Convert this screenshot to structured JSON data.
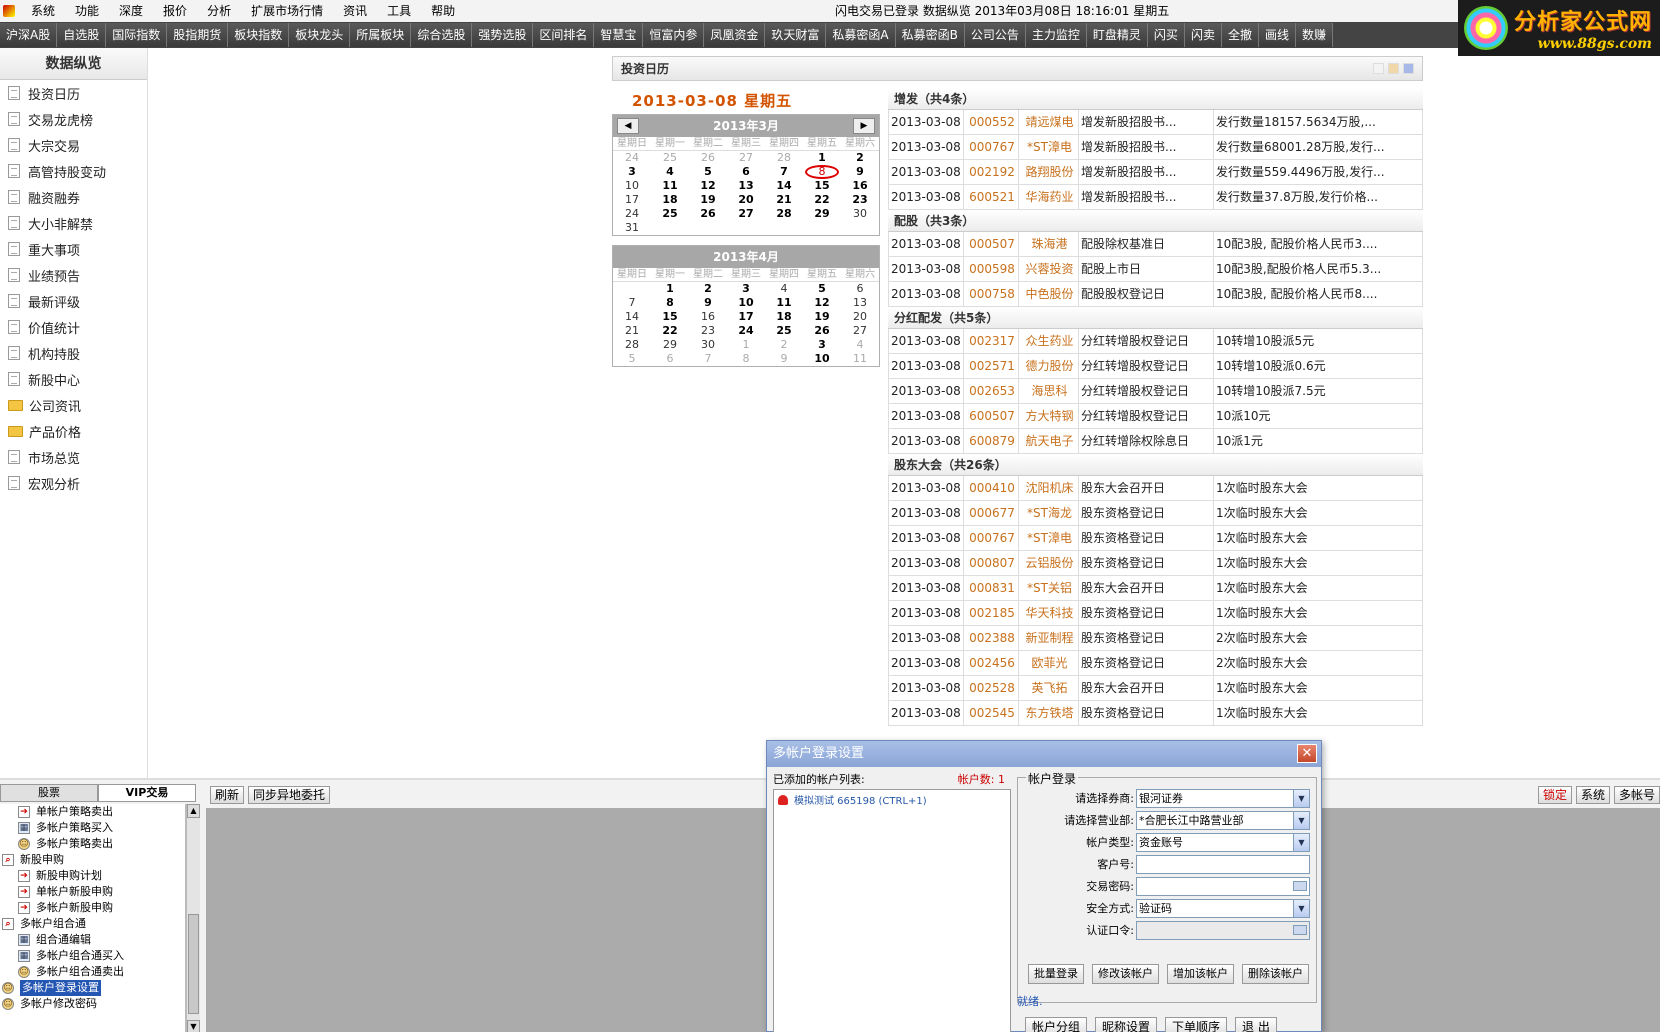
{
  "menu": {
    "items": [
      "系统",
      "功能",
      "深度",
      "报价",
      "分析",
      "扩展市场行情",
      "资讯",
      "工具",
      "帮助"
    ],
    "status": "闪电交易已登录    数据纵览  2013年03月08日  18:16:01  星期五"
  },
  "logo": {
    "brand": "分析家公式网",
    "url": "www.88gs.com"
  },
  "toolbar": [
    "沪深A股",
    "自选股",
    "国际指数",
    "股指期货",
    "板块指数",
    "板块龙头",
    "所属板块",
    "综合选股",
    "强势选股",
    "区间排名",
    "智慧宝",
    "恒富内参",
    "凤凰资金",
    "玖天财富",
    "私募密函A",
    "私募密函B",
    "公司公告",
    "主力监控",
    "盯盘精灵",
    "闪买",
    "闪卖",
    "全撤",
    "画线",
    "数赚"
  ],
  "sidebar": {
    "title": "数据纵览",
    "items": [
      {
        "label": "投资日历",
        "icon": "document-icon"
      },
      {
        "label": "交易龙虎榜",
        "icon": "document-icon"
      },
      {
        "label": "大宗交易",
        "icon": "document-icon"
      },
      {
        "label": "高管持股变动",
        "icon": "document-icon"
      },
      {
        "label": "融资融券",
        "icon": "document-icon"
      },
      {
        "label": "大小非解禁",
        "icon": "document-icon"
      },
      {
        "label": "重大事项",
        "icon": "document-icon"
      },
      {
        "label": "业绩预告",
        "icon": "document-icon"
      },
      {
        "label": "最新评级",
        "icon": "document-icon"
      },
      {
        "label": "价值统计",
        "icon": "document-icon"
      },
      {
        "label": "机构持股",
        "icon": "document-icon"
      },
      {
        "label": "新股中心",
        "icon": "document-icon"
      },
      {
        "label": "公司资讯",
        "icon": "folder-icon"
      },
      {
        "label": "产品价格",
        "icon": "folder-icon"
      },
      {
        "label": "市场总览",
        "icon": "document-icon"
      },
      {
        "label": "宏观分析",
        "icon": "document-icon"
      }
    ]
  },
  "calendar": {
    "panel_title": "投资日历",
    "selected_date": "2013-03-08  星期五",
    "swatch_colors": [
      "#f3f3f3",
      "#f0d8a8",
      "#a8b8e8"
    ],
    "weekdays": [
      "星期日",
      "星期一",
      "星期二",
      "星期三",
      "星期四",
      "星期五",
      "星期六"
    ],
    "months": [
      {
        "title": "2013年3月",
        "weeks": [
          [
            [
              "24",
              "dim"
            ],
            [
              "25",
              "dim"
            ],
            [
              "26",
              "dim"
            ],
            [
              "27",
              "dim"
            ],
            [
              "28",
              "dim"
            ],
            [
              "1",
              "bold"
            ],
            [
              "2",
              "bold"
            ]
          ],
          [
            [
              "3",
              "bold"
            ],
            [
              "4",
              "bold"
            ],
            [
              "5",
              "bold"
            ],
            [
              "6",
              "bold"
            ],
            [
              "7",
              "bold"
            ],
            [
              "8",
              "today"
            ],
            [
              "9",
              "bold"
            ]
          ],
          [
            [
              "10",
              "reg"
            ],
            [
              "11",
              "bold"
            ],
            [
              "12",
              "bold"
            ],
            [
              "13",
              "bold"
            ],
            [
              "14",
              "bold"
            ],
            [
              "15",
              "bold"
            ],
            [
              "16",
              "bold"
            ]
          ],
          [
            [
              "17",
              "reg"
            ],
            [
              "18",
              "bold"
            ],
            [
              "19",
              "bold"
            ],
            [
              "20",
              "bold"
            ],
            [
              "21",
              "bold"
            ],
            [
              "22",
              "bold"
            ],
            [
              "23",
              "bold"
            ]
          ],
          [
            [
              "24",
              "reg"
            ],
            [
              "25",
              "bold"
            ],
            [
              "26",
              "bold"
            ],
            [
              "27",
              "bold"
            ],
            [
              "28",
              "bold"
            ],
            [
              "29",
              "bold"
            ],
            [
              "30",
              "reg"
            ]
          ],
          [
            [
              "31",
              "reg"
            ]
          ]
        ]
      },
      {
        "title": "2013年4月",
        "weeks": [
          [
            [
              "",
              "reg"
            ],
            [
              "1",
              "bold"
            ],
            [
              "2",
              "bold"
            ],
            [
              "3",
              "bold"
            ],
            [
              "4",
              "reg"
            ],
            [
              "5",
              "bold"
            ],
            [
              "6",
              "reg"
            ]
          ],
          [
            [
              "7",
              "reg"
            ],
            [
              "8",
              "bold"
            ],
            [
              "9",
              "bold"
            ],
            [
              "10",
              "bold"
            ],
            [
              "11",
              "bold"
            ],
            [
              "12",
              "bold"
            ],
            [
              "13",
              "reg"
            ]
          ],
          [
            [
              "14",
              "reg"
            ],
            [
              "15",
              "bold"
            ],
            [
              "16",
              "reg"
            ],
            [
              "17",
              "bold"
            ],
            [
              "18",
              "bold"
            ],
            [
              "19",
              "bold"
            ],
            [
              "20",
              "reg"
            ]
          ],
          [
            [
              "21",
              "reg"
            ],
            [
              "22",
              "bold"
            ],
            [
              "23",
              "reg"
            ],
            [
              "24",
              "bold"
            ],
            [
              "25",
              "bold"
            ],
            [
              "26",
              "bold"
            ],
            [
              "27",
              "reg"
            ]
          ],
          [
            [
              "28",
              "reg"
            ],
            [
              "29",
              "reg"
            ],
            [
              "30",
              "reg"
            ],
            [
              "1",
              "dim"
            ],
            [
              "2",
              "dim"
            ],
            [
              "3",
              "bold"
            ],
            [
              "4",
              "dim"
            ]
          ],
          [
            [
              "5",
              "dim"
            ],
            [
              "6",
              "dim"
            ],
            [
              "7",
              "dim"
            ],
            [
              "8",
              "dim"
            ],
            [
              "9",
              "dim"
            ],
            [
              "10",
              "bold"
            ],
            [
              "11",
              "dim"
            ]
          ]
        ]
      }
    ]
  },
  "events": [
    {
      "title": "增发（共4条）",
      "rows": [
        [
          "2013-03-08",
          "000552",
          "靖远煤电",
          "增发新股招股书...",
          "发行数量18157.5634万股,..."
        ],
        [
          "2013-03-08",
          "000767",
          "*ST漳电",
          "增发新股招股书...",
          "发行数量68001.28万股,发行..."
        ],
        [
          "2013-03-08",
          "002192",
          "路翔股份",
          "增发新股招股书...",
          "发行数量559.4496万股,发行..."
        ],
        [
          "2013-03-08",
          "600521",
          "华海药业",
          "增发新股招股书...",
          "发行数量37.8万股,发行价格..."
        ]
      ]
    },
    {
      "title": "配股（共3条）",
      "rows": [
        [
          "2013-03-08",
          "000507",
          "珠海港",
          "配股除权基准日",
          "10配3股, 配股价格人民币3...."
        ],
        [
          "2013-03-08",
          "000598",
          "兴蓉投资",
          "配股上市日",
          "10配3股,配股价格人民币5.3..."
        ],
        [
          "2013-03-08",
          "000758",
          "中色股份",
          "配股股权登记日",
          "10配3股, 配股价格人民币8...."
        ]
      ]
    },
    {
      "title": "分红配发（共5条）",
      "rows": [
        [
          "2013-03-08",
          "002317",
          "众生药业",
          "分红转增股权登记日",
          "10转增10股派5元"
        ],
        [
          "2013-03-08",
          "002571",
          "德力股份",
          "分红转增股权登记日",
          "10转增10股派0.6元"
        ],
        [
          "2013-03-08",
          "002653",
          "海思科",
          "分红转增股权登记日",
          "10转增10股派7.5元"
        ],
        [
          "2013-03-08",
          "600507",
          "方大特钢",
          "分红转增股权登记日",
          "10派10元"
        ],
        [
          "2013-03-08",
          "600879",
          "航天电子",
          "分红转增除权除息日",
          "10派1元"
        ]
      ]
    },
    {
      "title": "股东大会（共26条）",
      "rows": [
        [
          "2013-03-08",
          "000410",
          "沈阳机床",
          "股东大会召开日",
          "1次临时股东大会"
        ],
        [
          "2013-03-08",
          "000677",
          "*ST海龙",
          "股东资格登记日",
          "1次临时股东大会"
        ],
        [
          "2013-03-08",
          "000767",
          "*ST漳电",
          "股东资格登记日",
          "1次临时股东大会"
        ],
        [
          "2013-03-08",
          "000807",
          "云铝股份",
          "股东资格登记日",
          "1次临时股东大会"
        ],
        [
          "2013-03-08",
          "000831",
          "*ST关铝",
          "股东大会召开日",
          "1次临时股东大会"
        ],
        [
          "2013-03-08",
          "002185",
          "华天科技",
          "股东资格登记日",
          "1次临时股东大会"
        ],
        [
          "2013-03-08",
          "002388",
          "新亚制程",
          "股东资格登记日",
          "2次临时股东大会"
        ],
        [
          "2013-03-08",
          "002456",
          "欧菲光",
          "股东资格登记日",
          "2次临时股东大会"
        ],
        [
          "2013-03-08",
          "002528",
          "英飞拓",
          "股东大会召开日",
          "1次临时股东大会"
        ],
        [
          "2013-03-08",
          "002545",
          "东方铁塔",
          "股东资格登记日",
          "1次临时股东大会"
        ]
      ]
    }
  ],
  "bottom": {
    "tabs": [
      "股票",
      "VIP交易"
    ],
    "toolbar": [
      "刷新",
      "同步异地委托"
    ],
    "right_buttons": [
      "锁定",
      "系统",
      "多帐号"
    ],
    "tree": [
      {
        "label": "单帐户策略卖出",
        "level": 1,
        "icon": "arrow-icon"
      },
      {
        "label": "多帐户策略买入",
        "level": 1,
        "icon": "grid-icon"
      },
      {
        "label": "多帐户策略卖出",
        "level": 1,
        "icon": "user-icon"
      },
      {
        "label": "新股申购",
        "level": 0,
        "icon": "search-icon"
      },
      {
        "label": "新股申购计划",
        "level": 1,
        "icon": "arrow-icon"
      },
      {
        "label": "单帐户新股申购",
        "level": 1,
        "icon": "arrow-icon"
      },
      {
        "label": "多帐户新股申购",
        "level": 1,
        "icon": "arrow-icon"
      },
      {
        "label": "多帐户组合通",
        "level": 0,
        "icon": "search-icon"
      },
      {
        "label": "组合通编辑",
        "level": 1,
        "icon": "grid-icon"
      },
      {
        "label": "多帐户组合通买入",
        "level": 1,
        "icon": "grid-icon"
      },
      {
        "label": "多帐户组合通卖出",
        "level": 1,
        "icon": "user-icon"
      },
      {
        "label": "多帐户登录设置",
        "level": 0,
        "icon": "user-icon",
        "selected": true
      },
      {
        "label": "多帐户修改密码",
        "level": 0,
        "icon": "user-icon"
      }
    ]
  },
  "dialog": {
    "title": "多帐户登录设置",
    "list_label": "已添加的帐户列表:",
    "count_label": "帐户数: 1",
    "accounts": [
      "模拟测试  665198 (CTRL+1)"
    ],
    "legend": "帐户登录",
    "fields": [
      {
        "label": "请选择券商:",
        "value": "银河证券",
        "type": "select"
      },
      {
        "label": "请选择营业部:",
        "value": "*合肥长江中路营业部",
        "type": "select"
      },
      {
        "label": "帐户类型:",
        "value": "资金账号",
        "type": "select"
      },
      {
        "label": "客户号:",
        "value": "",
        "type": "text"
      },
      {
        "label": "交易密码:",
        "value": "",
        "type": "password"
      },
      {
        "label": "安全方式:",
        "value": "验证码",
        "type": "select"
      },
      {
        "label": "认证口令:",
        "value": "",
        "type": "password-disabled"
      }
    ],
    "buttons": [
      "批量登录",
      "修改该帐户",
      "增加该帐户",
      "删除该帐户"
    ],
    "status": "就绪.",
    "bottom_buttons": [
      "帐户分组",
      "昵称设置",
      "下单顺序",
      "退 出"
    ]
  }
}
